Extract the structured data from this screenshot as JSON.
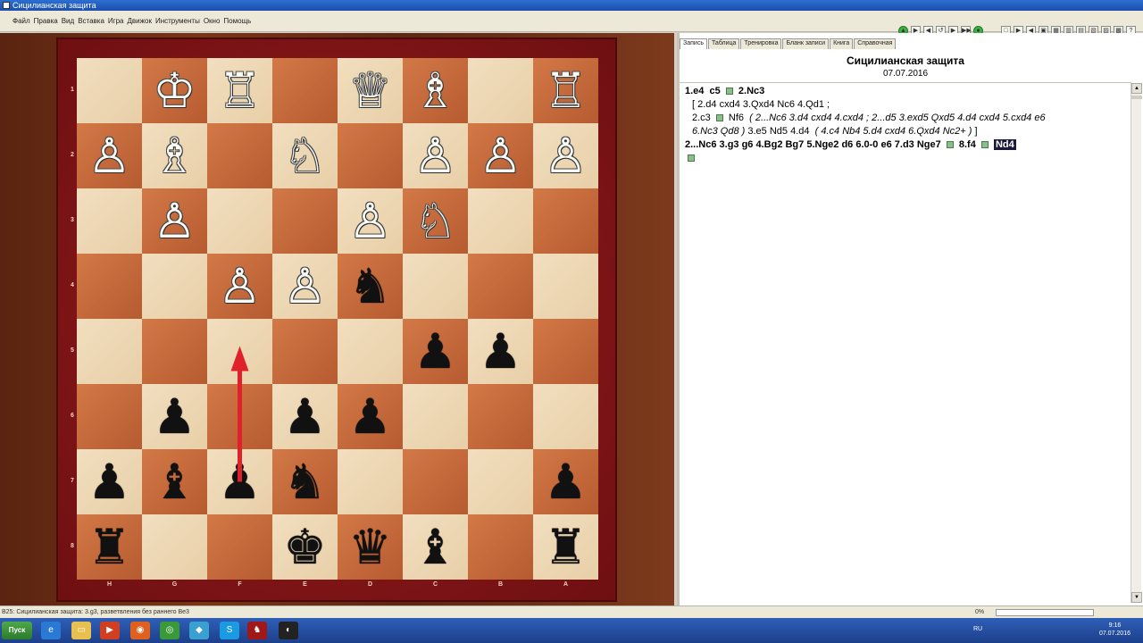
{
  "window": {
    "title": "Сицилианская защита"
  },
  "menu": [
    "Файл",
    "Правка",
    "Вид",
    "Вставка",
    "Игра",
    "Движок",
    "Инструменты",
    "Окно",
    "Помощь"
  ],
  "toolbar": [
    "▲",
    "▶",
    "◀",
    "↺",
    "▶",
    "▶▶",
    "●",
    "□",
    "▶",
    "◀",
    "▣",
    "▦",
    "▥",
    "▤",
    "▧",
    "▨",
    "▩",
    "?"
  ],
  "tabs": [
    "Запись",
    "Таблица",
    "Тренировка",
    "Бланк записи",
    "Книга",
    "Справочная"
  ],
  "game": {
    "title": "Сицилианская защита",
    "date": "07.07.2016"
  },
  "board": {
    "rank_labels": [
      "1",
      "2",
      "3",
      "4",
      "5",
      "6",
      "7",
      "8"
    ],
    "file_labels": [
      "H",
      "G",
      "F",
      "E",
      "D",
      "C",
      "B",
      "A"
    ],
    "pieces": [
      {
        "sq": "g1",
        "p": "♔",
        "c": "w"
      },
      {
        "sq": "f1",
        "p": "♖",
        "c": "w"
      },
      {
        "sq": "d1",
        "p": "♕",
        "c": "w"
      },
      {
        "sq": "c1",
        "p": "♗",
        "c": "w"
      },
      {
        "sq": "a1",
        "p": "♖",
        "c": "w"
      },
      {
        "sq": "h2",
        "p": "♙",
        "c": "w"
      },
      {
        "sq": "g2",
        "p": "♗",
        "c": "w"
      },
      {
        "sq": "e2",
        "p": "♘",
        "c": "w"
      },
      {
        "sq": "c2",
        "p": "♙",
        "c": "w"
      },
      {
        "sq": "b2",
        "p": "♙",
        "c": "w"
      },
      {
        "sq": "a2",
        "p": "♙",
        "c": "w"
      },
      {
        "sq": "g3",
        "p": "♙",
        "c": "w"
      },
      {
        "sq": "d3",
        "p": "♙",
        "c": "w"
      },
      {
        "sq": "c3",
        "p": "♘",
        "c": "w"
      },
      {
        "sq": "f4",
        "p": "♙",
        "c": "w"
      },
      {
        "sq": "e4",
        "p": "♙",
        "c": "w"
      },
      {
        "sq": "d4",
        "p": "♞",
        "c": "b"
      },
      {
        "sq": "c5",
        "p": "♟",
        "c": "b"
      },
      {
        "sq": "b5",
        "p": "♟",
        "c": "b"
      },
      {
        "sq": "g6",
        "p": "♟",
        "c": "b"
      },
      {
        "sq": "e6",
        "p": "♟",
        "c": "b"
      },
      {
        "sq": "d6",
        "p": "♟",
        "c": "b"
      },
      {
        "sq": "h7",
        "p": "♟",
        "c": "b"
      },
      {
        "sq": "g7",
        "p": "♝",
        "c": "b"
      },
      {
        "sq": "f7",
        "p": "♟",
        "c": "b"
      },
      {
        "sq": "e7",
        "p": "♞",
        "c": "b"
      },
      {
        "sq": "a7",
        "p": "♟",
        "c": "b"
      },
      {
        "sq": "h8",
        "p": "♜",
        "c": "b"
      },
      {
        "sq": "e8",
        "p": "♚",
        "c": "b"
      },
      {
        "sq": "d8",
        "p": "♛",
        "c": "b"
      },
      {
        "sq": "c8",
        "p": "♝",
        "c": "b"
      },
      {
        "sq": "a8",
        "p": "♜",
        "c": "b"
      }
    ],
    "arrow": {
      "from": "f7",
      "to": "f5",
      "color": "#e0202a"
    }
  },
  "notation": {
    "line1": [
      "1.e4",
      "c5",
      "2.Nc3"
    ],
    "var1": "[ 2.d4  cxd4  3.Qxd4  Nc6  4.Qd1 ;",
    "var2a": "2.c3",
    "var2b": "Nf6",
    "var2c": "( 2...Nc6  3.d4  cxd4  4.cxd4 ; 2...d5  3.exd5  Qxd5  4.d4  cxd4  5.cxd4  e6",
    "var3a": "6.Nc3  Qd8 )",
    "var3b": "3.e5  Nd5  4.d4",
    "var3c": "( 4.c4  Nb4  5.d4  cxd4  6.Qxd4  Nc2+ )",
    "var3d": "]",
    "main": "2...Nc6  3.g3  g6  4.Bg2  Bg7  5.Nge2  d6  6.0-0  e6  7.d3  Nge7",
    "main2": "8.f4",
    "current": "Nd4"
  },
  "status": {
    "text": "B25: Сицилианская защита: 3.g3, разветвления без раннего Be3",
    "percent": "0%"
  },
  "taskbar": {
    "start": "Пуск",
    "lang": "RU",
    "time": "9:16",
    "date": "07.07.2016"
  }
}
